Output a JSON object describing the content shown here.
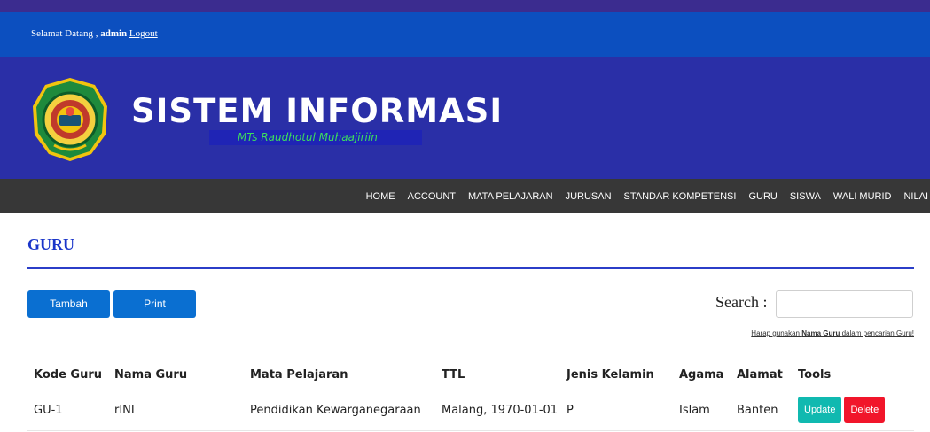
{
  "header": {
    "welcome_prefix": "Selamat Datang ,",
    "username": "admin",
    "logout_label": "Logout"
  },
  "banner": {
    "title": "SISTEM INFORMASI",
    "subtitle": "MTs Raudhotul Muhaajiriin",
    "logo_icon": "school-emblem-icon"
  },
  "nav": {
    "items": [
      "HOME",
      "ACCOUNT",
      "MATA PELAJARAN",
      "JURUSAN",
      "STANDAR KOMPETENSI",
      "GURU",
      "SISWA",
      "WALI MURID",
      "NILAI"
    ]
  },
  "page": {
    "title": "GURU"
  },
  "toolbar": {
    "add_label": "Tambah",
    "print_label": "Print",
    "search_label": "Search :",
    "search_value": "",
    "hint_prefix": "Harap gunakan",
    "hint_bold": "Nama Guru",
    "hint_suffix": "dalam pencarian Guru!"
  },
  "table": {
    "columns": [
      "Kode Guru",
      "Nama Guru",
      "Mata Pelajaran",
      "TTL",
      "Jenis Kelamin",
      "Agama",
      "Alamat",
      "Tools"
    ],
    "rows": [
      {
        "kode": "GU-1",
        "nama": "rINI",
        "mapel": "Pendidikan Kewarganegaraan",
        "ttl": "Malang, 1970-01-01",
        "jk": "P",
        "agama": "Islam",
        "alamat": "Banten",
        "update_label": "Update",
        "delete_label": "Delete"
      }
    ]
  },
  "colors": {
    "topbar": "#0c4fbf",
    "banner": "#2a2fa7",
    "navbar": "#373737",
    "primary_button": "#0a6fd1",
    "update_button": "#10b9b0",
    "delete_button": "#f1152a",
    "title_text": "#1a35c9"
  }
}
